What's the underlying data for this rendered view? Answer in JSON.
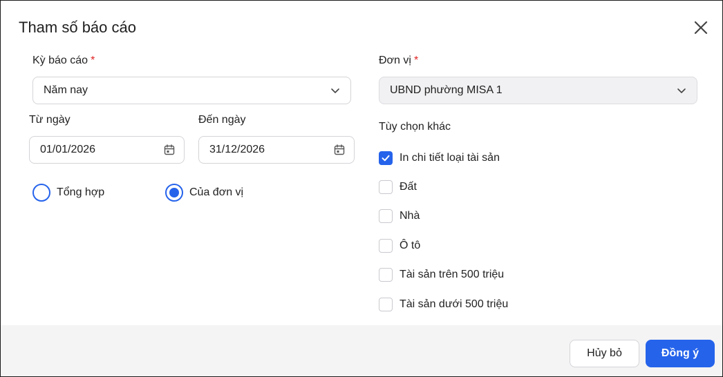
{
  "dialog": {
    "title": "Tham số báo cáo"
  },
  "report_period": {
    "label": "Kỳ báo cáo",
    "required_mark": "*",
    "value": "Năm nay"
  },
  "unit": {
    "label": "Đơn vị",
    "required_mark": "*",
    "value": "UBND phường MISA 1"
  },
  "from_date": {
    "label": "Từ ngày",
    "value": "01/01/2026"
  },
  "to_date": {
    "label": "Đến ngày",
    "value": "31/12/2026"
  },
  "scope": {
    "options": [
      {
        "label": "Tổng hợp",
        "selected": false
      },
      {
        "label": "Của đơn vị",
        "selected": true
      }
    ]
  },
  "other_options": {
    "label": "Tùy chọn khác",
    "items": [
      {
        "label": "In chi tiết loại tài sản",
        "checked": true
      },
      {
        "label": "Đất",
        "checked": false
      },
      {
        "label": "Nhà",
        "checked": false
      },
      {
        "label": "Ô tô",
        "checked": false
      },
      {
        "label": "Tài sản trên 500 triệu",
        "checked": false
      },
      {
        "label": "Tài sản dưới 500 triệu",
        "checked": false
      }
    ]
  },
  "footer": {
    "cancel_label": "Hủy bỏ",
    "ok_label": "Đồng ý"
  },
  "colors": {
    "accent": "#2563eb",
    "required": "#e02424",
    "footer_bg": "#f4f4f5"
  },
  "icons": {
    "close": "close-icon",
    "dropdown": "chevron-down-icon",
    "calendar": "calendar-icon",
    "check": "checkmark-icon"
  }
}
